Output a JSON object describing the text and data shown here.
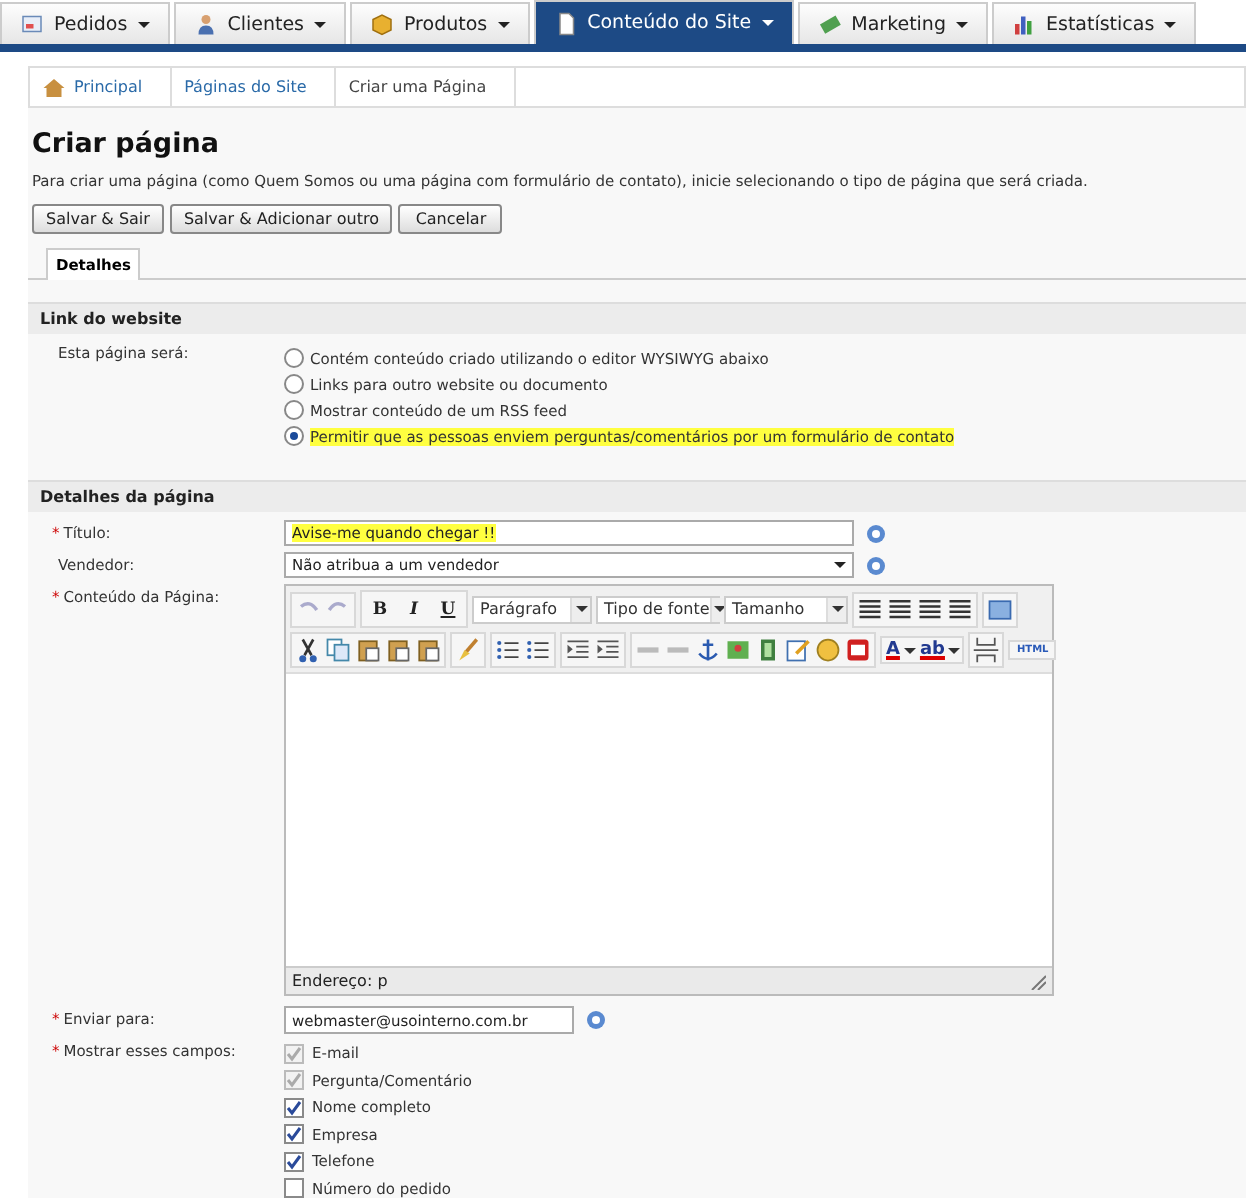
{
  "nav_tabs": [
    {
      "label": "Pedidos",
      "selected": false
    },
    {
      "label": "Clientes",
      "selected": false
    },
    {
      "label": "Produtos",
      "selected": false
    },
    {
      "label": "Conteúdo do Site",
      "selected": true
    },
    {
      "label": "Marketing",
      "selected": false
    },
    {
      "label": "Estatísticas",
      "selected": false
    }
  ],
  "breadcrumb": [
    "Principal",
    "Páginas do Site",
    "Criar uma Página"
  ],
  "title": "Criar página",
  "description": "Para criar uma página (como Quem Somos ou uma página com formulário de contato), inicie selecionando o tipo de página que será criada.",
  "buttons": [
    "Salvar & Sair",
    "Salvar & Adicionar outro",
    "Cancelar"
  ],
  "tabs": [
    {
      "label": "Detalhes",
      "selected": true
    }
  ],
  "link_section": {
    "heading": "Link do website",
    "label": "Esta página será:",
    "options": [
      {
        "label": "Contém conteúdo criado utilizando o editor WYSIWYG abaixo",
        "selected": false,
        "highlighted": false
      },
      {
        "label": "Links para outro website ou documento",
        "selected": false,
        "highlighted": false
      },
      {
        "label": "Mostrar conteúdo de um RSS feed",
        "selected": false,
        "highlighted": false
      },
      {
        "label": "Permitir que as pessoas enviem perguntas/comentários por um formulário de contato",
        "selected": true,
        "highlighted": true
      }
    ]
  },
  "details_section": {
    "heading": "Detalhes da página",
    "title_field": {
      "required_mark": "*",
      "label": "Título:",
      "value": "Avise-me quando chegar !!",
      "highlighted": true
    },
    "vendor_field": {
      "label": "Vendedor:",
      "value": "Não atribua a um vendedor"
    },
    "content_field": {
      "required_mark": "*",
      "label": "Conteúdo da Página:"
    },
    "editor": {
      "format_buttons": [
        "B",
        "I",
        "U"
      ],
      "selects": [
        "Parágrafo",
        "Tipo de fonte",
        "Tamanho"
      ],
      "color_buttons": [
        "A",
        "ab"
      ],
      "html_button": "HTML",
      "status": "Endereço: p"
    },
    "send_to": {
      "required_mark": "*",
      "label": "Enviar para:",
      "value": "webmaster@usointerno.com.br"
    },
    "fields": {
      "required_mark": "*",
      "label": "Mostrar esses campos:",
      "items": [
        {
          "label": "E-mail",
          "checked": true,
          "disabled": true
        },
        {
          "label": "Pergunta/Comentário",
          "checked": true,
          "disabled": true
        },
        {
          "label": "Nome completo",
          "checked": true,
          "disabled": false
        },
        {
          "label": "Empresa",
          "checked": true,
          "disabled": false
        },
        {
          "label": "Telefone",
          "checked": true,
          "disabled": false
        },
        {
          "label": "Número do pedido",
          "checked": false,
          "disabled": false
        }
      ]
    }
  }
}
